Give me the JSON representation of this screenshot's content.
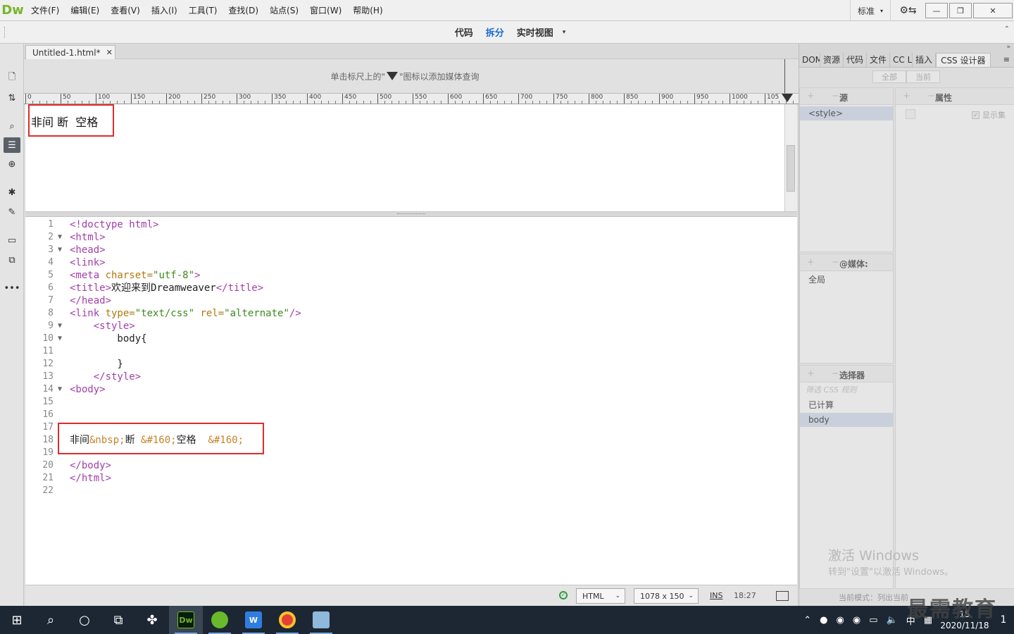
{
  "app": {
    "logo": "Dw"
  },
  "menu": [
    "文件(F)",
    "编辑(E)",
    "查看(V)",
    "插入(I)",
    "工具(T)",
    "查找(D)",
    "站点(S)",
    "窗口(W)",
    "帮助(H)"
  ],
  "workspace": {
    "label": "标准",
    "caret": "▾"
  },
  "window_controls": {
    "minimize": "—",
    "restore": "❐",
    "close": "✕",
    "sync": "⚙⇆"
  },
  "views": {
    "code": "代码",
    "split": "拆分",
    "live": "实时视图",
    "caret": "▾"
  },
  "document_tab": {
    "name": "Untitled-1.html*",
    "close": "✕"
  },
  "media_query_bar": {
    "before": "单击标尺上的\"",
    "after": "\"图标以添加媒体查询"
  },
  "ruler": {
    "labels": [
      "0",
      "50",
      "100",
      "150",
      "200",
      "250",
      "300",
      "350",
      "400",
      "450",
      "500",
      "550",
      "600",
      "650",
      "700",
      "750",
      "800",
      "850",
      "900",
      "950",
      "1000",
      "105"
    ]
  },
  "live_view": {
    "text": "非间 断  空格"
  },
  "code_lines": [
    {
      "n": "1",
      "fold": "",
      "parts": [
        {
          "t": "tag",
          "s": "<!doctype html>"
        }
      ]
    },
    {
      "n": "2",
      "fold": "▼",
      "parts": [
        {
          "t": "tag",
          "s": "<html>"
        }
      ]
    },
    {
      "n": "3",
      "fold": "▼",
      "parts": [
        {
          "t": "tag",
          "s": "<head>"
        }
      ]
    },
    {
      "n": "4",
      "fold": "",
      "parts": [
        {
          "t": "tag",
          "s": "<link>"
        }
      ]
    },
    {
      "n": "5",
      "fold": "",
      "parts": [
        {
          "t": "tag",
          "s": "<meta "
        },
        {
          "t": "attr",
          "s": "charset="
        },
        {
          "t": "val",
          "s": "\"utf-8\""
        },
        {
          "t": "tag",
          "s": ">"
        }
      ]
    },
    {
      "n": "6",
      "fold": "",
      "parts": [
        {
          "t": "tag",
          "s": "<title>"
        },
        {
          "t": "txt",
          "s": "欢迎来到Dreamweaver"
        },
        {
          "t": "tag",
          "s": "</title>"
        }
      ]
    },
    {
      "n": "7",
      "fold": "",
      "parts": [
        {
          "t": "tag",
          "s": "</head>"
        }
      ]
    },
    {
      "n": "8",
      "fold": "",
      "parts": [
        {
          "t": "tag",
          "s": "<link "
        },
        {
          "t": "attr",
          "s": "type="
        },
        {
          "t": "val",
          "s": "\"text/css\" "
        },
        {
          "t": "attr",
          "s": "rel="
        },
        {
          "t": "val",
          "s": "\"alternate\""
        },
        {
          "t": "tag",
          "s": "/>"
        }
      ]
    },
    {
      "n": "9",
      "fold": "▼",
      "parts": [
        {
          "t": "txt",
          "s": "    "
        },
        {
          "t": "tag",
          "s": "<style>"
        }
      ]
    },
    {
      "n": "10",
      "fold": "▼",
      "parts": [
        {
          "t": "txt",
          "s": "        body{"
        }
      ]
    },
    {
      "n": "11",
      "fold": "",
      "parts": []
    },
    {
      "n": "12",
      "fold": "",
      "parts": [
        {
          "t": "txt",
          "s": "        }"
        }
      ]
    },
    {
      "n": "13",
      "fold": "",
      "parts": [
        {
          "t": "txt",
          "s": "    "
        },
        {
          "t": "tag",
          "s": "</style>"
        }
      ]
    },
    {
      "n": "14",
      "fold": "▼",
      "parts": [
        {
          "t": "tag",
          "s": "<body>"
        }
      ]
    },
    {
      "n": "15",
      "fold": "",
      "parts": []
    },
    {
      "n": "16",
      "fold": "",
      "parts": []
    },
    {
      "n": "17",
      "fold": "",
      "parts": []
    },
    {
      "n": "18",
      "fold": "",
      "parts": [
        {
          "t": "txt",
          "s": "非间"
        },
        {
          "t": "ent",
          "s": "&nbsp;"
        },
        {
          "t": "txt",
          "s": "断 "
        },
        {
          "t": "ent",
          "s": "&#160;"
        },
        {
          "t": "txt",
          "s": "空格  "
        },
        {
          "t": "ent",
          "s": "&#160;"
        }
      ]
    },
    {
      "n": "19",
      "fold": "",
      "parts": []
    },
    {
      "n": "20",
      "fold": "",
      "parts": [
        {
          "t": "tag",
          "s": "</body>"
        }
      ]
    },
    {
      "n": "21",
      "fold": "",
      "parts": [
        {
          "t": "tag",
          "s": "</html>"
        }
      ]
    },
    {
      "n": "22",
      "fold": "",
      "parts": []
    }
  ],
  "status": {
    "ok": "✓",
    "doc_type": "HTML",
    "size": "1078 x 150",
    "caret": "⌄",
    "mode": "INS",
    "position": "18:27"
  },
  "panel": {
    "tabs": [
      "DOM",
      "资源",
      "代码",
      "文件",
      "CC L",
      "插入",
      "CSS 设计器"
    ],
    "menu_icon": "≡",
    "toggle_all": "全部",
    "toggle_current": "当前",
    "sources_title": "源",
    "source_item": "<style>",
    "properties_title": "属性",
    "show_set": "显示集",
    "media_title": "@媒体:",
    "media_item": "全局",
    "selectors_title": "选择器",
    "filter_placeholder": "筛选 CSS 规则",
    "computed": "已计算",
    "selector_item": "body",
    "plus_minus": "+ −",
    "mode_text": "当前模式：列出当前",
    "watermark_title": "激活 Windows",
    "watermark_sub": "转到\"设置\"以激活 Windows。"
  },
  "brand": "最需教育",
  "taskbar": {
    "ime": "中",
    "date": "2020/11/18",
    "time": "15",
    "notifications": "1"
  }
}
